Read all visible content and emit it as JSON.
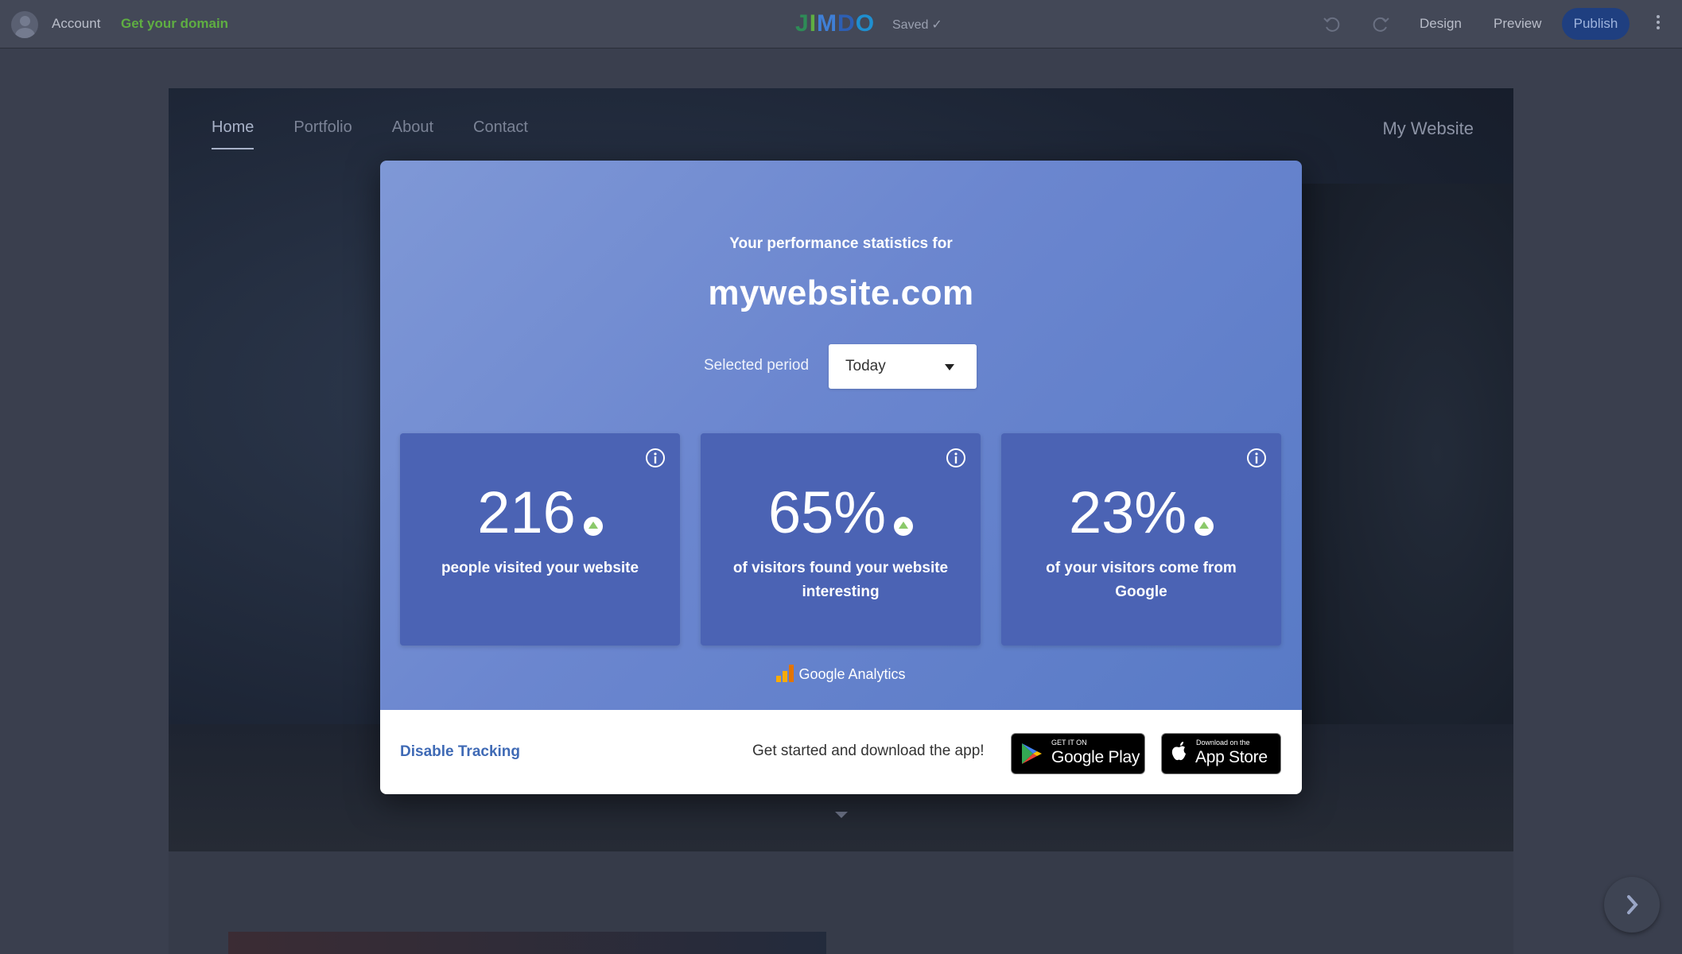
{
  "topbar": {
    "account_label": "Account",
    "domain_link": "Get your domain",
    "logo_letters": [
      "J",
      "I",
      "M",
      "D",
      "O"
    ],
    "logo_colors": [
      "#2e8b57",
      "#5fae42",
      "#3f7fd6",
      "#2d5fb3",
      "#1f8fd0"
    ],
    "saved_status": "Saved",
    "design_label": "Design",
    "preview_label": "Preview",
    "publish_label": "Publish"
  },
  "site": {
    "nav": [
      "Home",
      "Portfolio",
      "About",
      "Contact"
    ],
    "title": "My Website"
  },
  "modal": {
    "subtitle": "Your performance statistics for",
    "domain": "mywebsite.com",
    "period_label": "Selected period",
    "period_value": "Today",
    "stats": [
      {
        "value": "216",
        "description": "people visited your website",
        "trend": "up"
      },
      {
        "value": "65%",
        "description": "of visitors found your website interesting",
        "trend": "up"
      },
      {
        "value": "23%",
        "description": "of your visitors come from Google",
        "trend": "up"
      }
    ],
    "analytics_label": "Google Analytics",
    "disable_tracking": "Disable Tracking",
    "app_prompt": "Get started and download the app!",
    "google_play": {
      "small": "GET IT ON",
      "big": "Google Play"
    },
    "app_store": {
      "small": "Download on the",
      "big": "App Store"
    }
  },
  "colors": {
    "accent_green": "#5fae42",
    "publish_bg": "#1f3f80",
    "modal_gradient_start": "#7f98d6",
    "modal_gradient_end": "#587ac6",
    "card_bg": "#4b63b4",
    "link_blue": "#3f6ab5"
  }
}
